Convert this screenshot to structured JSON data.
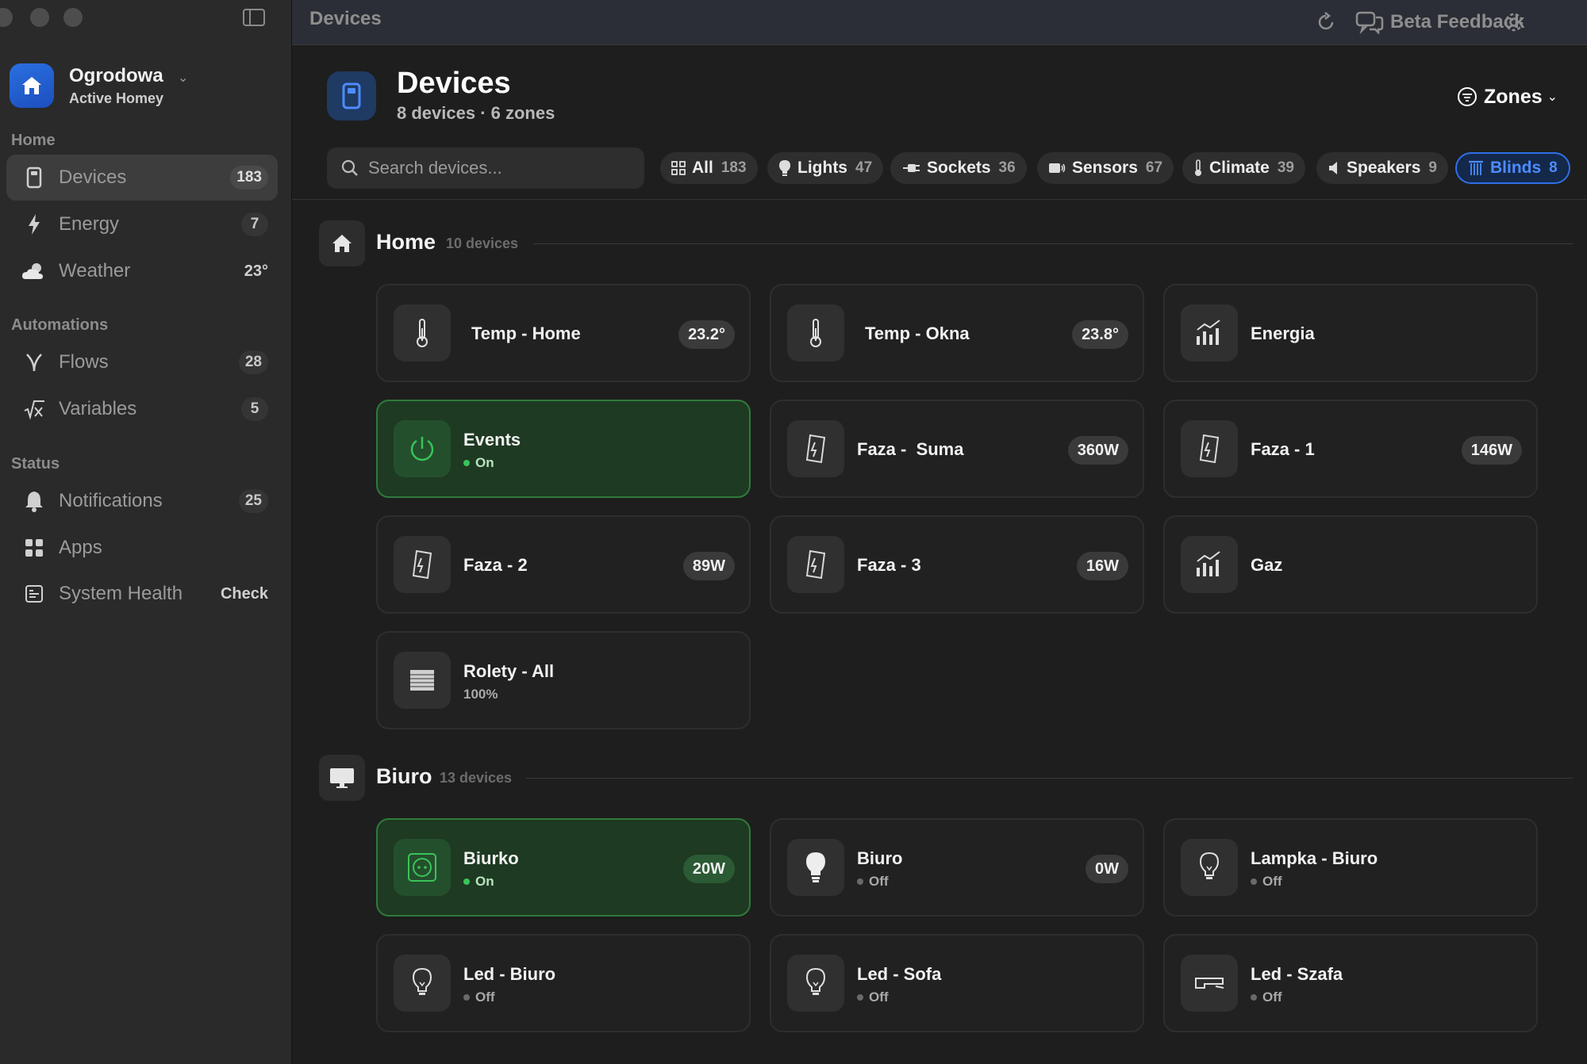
{
  "window": {
    "title": "Devices"
  },
  "topbar": {
    "title": "Devices",
    "feedback_label": "Beta Feedback"
  },
  "home": {
    "name": "Ogrodowa",
    "subtitle": "Active Homey"
  },
  "sidebar": {
    "sections": [
      {
        "title": "Home"
      },
      {
        "title": "Automations"
      },
      {
        "title": "Status"
      }
    ],
    "items": [
      {
        "label": "Devices",
        "count": "183",
        "icon": "device-icon",
        "active": true
      },
      {
        "label": "Energy",
        "count": "7",
        "icon": "lightning-icon"
      },
      {
        "label": "Weather",
        "count": "23°",
        "icon": "weather-icon"
      },
      {
        "label": "Flows",
        "count": "28",
        "icon": "flows-icon"
      },
      {
        "label": "Variables",
        "count": "5",
        "icon": "variables-icon"
      },
      {
        "label": "Notifications",
        "count": "25",
        "icon": "bell-icon"
      },
      {
        "label": "Apps",
        "count": "",
        "icon": "apps-icon"
      },
      {
        "label": "System Health",
        "count": "Check",
        "icon": "system-health-icon"
      }
    ]
  },
  "page": {
    "title": "Devices",
    "subtitle": "8 devices · 6 zones",
    "zones_label": "Zones"
  },
  "search": {
    "placeholder": "Search devices..."
  },
  "filters": [
    {
      "label": "All",
      "count": "183",
      "icon": "grid-icon"
    },
    {
      "label": "Lights",
      "count": "47",
      "icon": "bulb-icon"
    },
    {
      "label": "Sockets",
      "count": "36",
      "icon": "plug-icon"
    },
    {
      "label": "Sensors",
      "count": "67",
      "icon": "sensor-icon"
    },
    {
      "label": "Climate",
      "count": "39",
      "icon": "thermometer-icon"
    },
    {
      "label": "Speakers",
      "count": "9",
      "icon": "speaker-icon"
    },
    {
      "label": "Blinds",
      "count": "8",
      "icon": "blinds-icon",
      "active": true
    }
  ],
  "zones": [
    {
      "name": "Home",
      "count": "10 devices",
      "devices": [
        {
          "name": "Temp - Home",
          "value": "23.2°"
        },
        {
          "name": "Temp - Okna",
          "value": "23.8°"
        },
        {
          "name": "Energia"
        },
        {
          "name": "Events",
          "status": "On"
        },
        {
          "name": "Faza -  Suma",
          "value": "360W"
        },
        {
          "name": "Faza - 1",
          "value": "146W"
        },
        {
          "name": "Faza - 2",
          "value": "89W"
        },
        {
          "name": "Faza - 3",
          "value": "16W"
        },
        {
          "name": "Gaz"
        },
        {
          "name": "Rolety - All",
          "status": "100%"
        }
      ]
    },
    {
      "name": "Biuro",
      "count": "13 devices",
      "devices": [
        {
          "name": "Biurko",
          "status": "On",
          "value": "20W"
        },
        {
          "name": "Biuro",
          "status": "Off",
          "value": "0W"
        },
        {
          "name": "Lampka - Biuro",
          "status": "Off"
        },
        {
          "name": "Led - Biuro",
          "status": "Off"
        },
        {
          "name": "Led - Sofa",
          "status": "Off"
        },
        {
          "name": "Led - Szafa",
          "status": "Off"
        }
      ]
    }
  ],
  "colors": {
    "accent": "#2f6fe6",
    "on_green": "#39c35a",
    "card_on_bg": "#1e3a22"
  }
}
